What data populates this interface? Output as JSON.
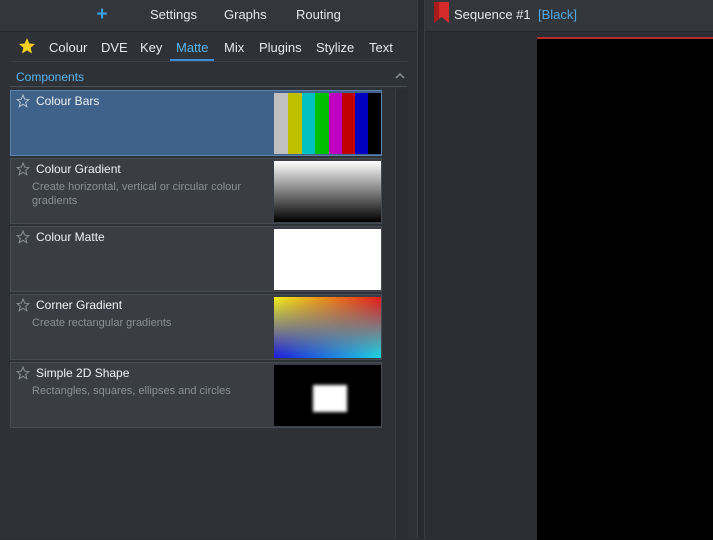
{
  "toolbar": {
    "add_icon": "plus-icon",
    "add_label": "+",
    "settings_label": "Settings",
    "graphs_label": "Graphs",
    "routing_label": "Routing"
  },
  "tabs": {
    "favorites_icon": "star-icon",
    "items": [
      "Colour",
      "DVE",
      "Key",
      "Matte",
      "Mix",
      "Plugins",
      "Stylize",
      "Text"
    ],
    "active": "Matte"
  },
  "section": {
    "title": "Components",
    "collapse_icon": "chevron-up-icon"
  },
  "components": [
    {
      "title": "Colour Bars",
      "description": "",
      "selected": true,
      "thumbnail": "colour-bars"
    },
    {
      "title": "Colour Gradient",
      "description": "Create horizontal, vertical or circular colour gradients",
      "selected": false,
      "thumbnail": "vertical-gradient"
    },
    {
      "title": "Colour Matte",
      "description": "",
      "selected": false,
      "thumbnail": "white-matte"
    },
    {
      "title": "Corner Gradient",
      "description": "Create rectangular gradients",
      "selected": false,
      "thumbnail": "corner-gradient"
    },
    {
      "title": "Simple 2D Shape",
      "description": "Rectangles, squares, ellipses and circles",
      "selected": false,
      "thumbnail": "shape"
    }
  ],
  "sequence": {
    "title": "Sequence #1",
    "source": "[Black]",
    "bookmark_icon": "bookmark-icon",
    "accent_color": "#b52a2a"
  },
  "colors": {
    "accent": "#3d8fd8",
    "active_tab": "#5ab4f0",
    "selected_item": "#3e6289",
    "star": "#f5d020"
  }
}
